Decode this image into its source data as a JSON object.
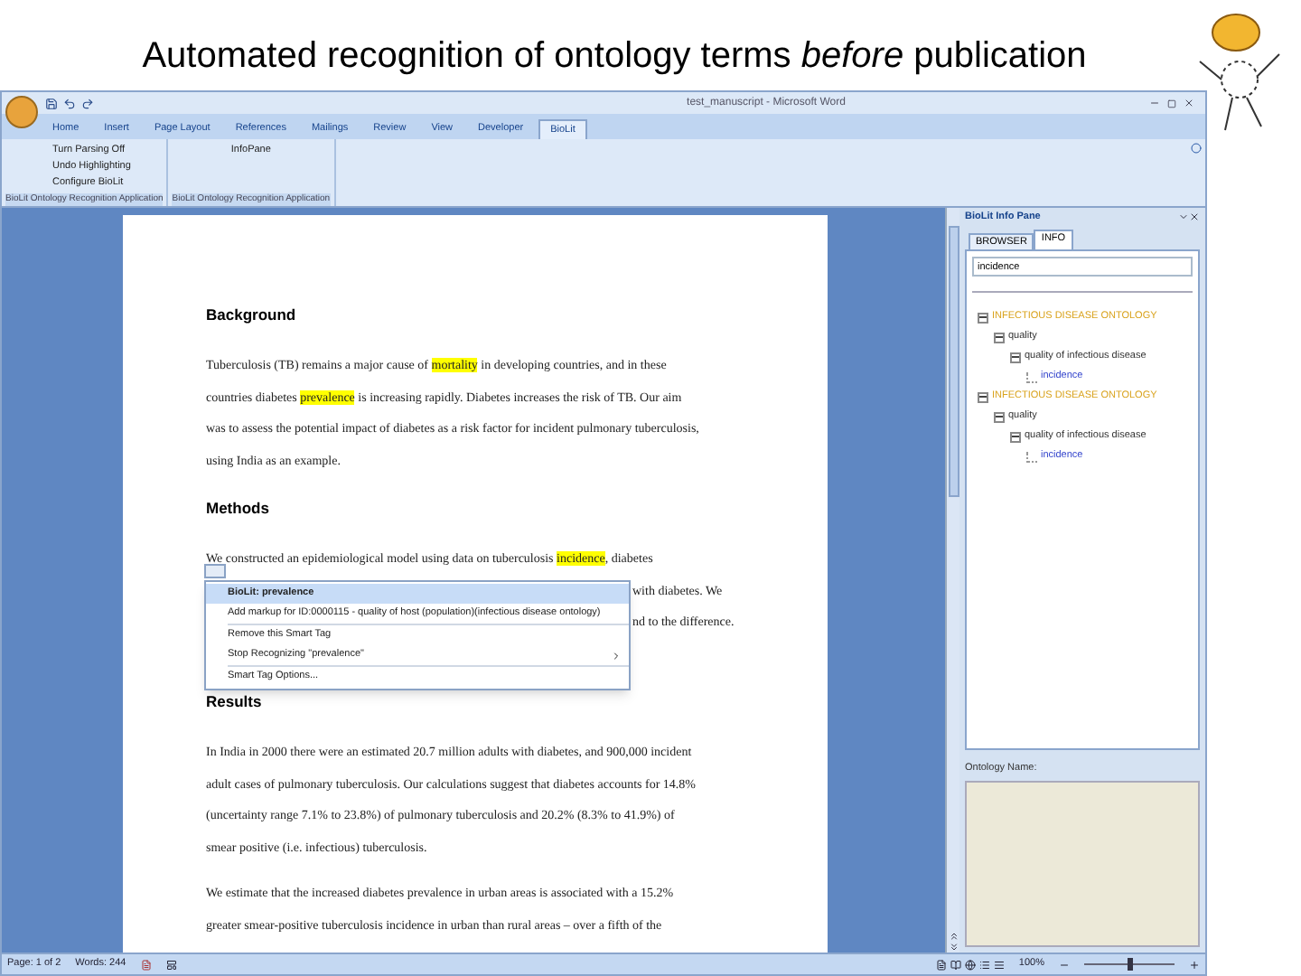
{
  "slide_title": "Automated recognition of ontology terms *before* publication",
  "window": {
    "title": "test_manuscript - Microsoft Word"
  },
  "ribbon_tabs": [
    {
      "label": "Home",
      "selected": false
    },
    {
      "label": "Insert",
      "selected": false
    },
    {
      "label": "Page Layout",
      "selected": false
    },
    {
      "label": "References",
      "selected": false
    },
    {
      "label": "Mailings",
      "selected": false
    },
    {
      "label": "Review",
      "selected": false
    },
    {
      "label": "View",
      "selected": false
    },
    {
      "label": "Developer",
      "selected": false
    },
    {
      "label": "BioLit",
      "selected": true
    }
  ],
  "ribbon_groups": [
    {
      "label": "BioLit Ontology Recognition Application",
      "buttons": [
        "Turn Parsing Off",
        "Undo Highlighting",
        "Configure BioLit"
      ]
    },
    {
      "label": "BioLit Ontology Recognition Application",
      "buttons": [
        "InfoPane"
      ]
    }
  ],
  "document": [
    {
      "heading": "Background",
      "paragraphs": [
        {
          "lines": [
            [
              {
                "text": "Tuberculosis (TB) remains a major cause of ",
                "highlighted": false
              },
              {
                "text": "mortality",
                "highlighted": true
              },
              {
                "text": " in developing countries, and in these",
                "highlighted": false
              }
            ],
            [
              {
                "text": "countries diabetes ",
                "highlighted": false
              },
              {
                "text": "prevalence",
                "highlighted": true
              },
              {
                "text": " is increasing rapidly. Diabetes increases the risk of TB. Our aim",
                "highlighted": false
              }
            ],
            [
              {
                "text": "was to assess the potential impact of diabetes as a risk factor for incident pulmonary tuberculosis,",
                "highlighted": false
              }
            ],
            [
              {
                "text": "using India as an example.",
                "highlighted": false
              }
            ]
          ]
        }
      ]
    },
    {
      "heading": "Methods",
      "paragraphs": [
        {
          "lines": [
            [
              {
                "text": "We constructed an epidemiological model using data on tuberculosis ",
                "highlighted": false
              },
              {
                "text": "incidence",
                "highlighted": true
              },
              {
                "text": ", diabetes",
                "highlighted": false
              }
            ]
          ],
          "partly_covered_lines": [
            "with diabetes. We",
            "nd to the difference."
          ]
        }
      ]
    },
    {
      "heading": "Results",
      "paragraphs": [
        {
          "lines": [
            [
              {
                "text": "In India in 2000 there were an estimated 20.7 million adults with diabetes, and 900,000 incident",
                "highlighted": false
              }
            ],
            [
              {
                "text": "adult cases of pulmonary tuberculosis. Our calculations suggest that diabetes accounts for 14.8%",
                "highlighted": false
              }
            ],
            [
              {
                "text": "(uncertainty range 7.1% to 23.8%) of pulmonary tuberculosis and 20.2% (8.3% to 41.9%) of",
                "highlighted": false
              }
            ],
            [
              {
                "text": "smear positive (i.e. infectious) tuberculosis.",
                "highlighted": false
              }
            ]
          ]
        },
        {
          "lines": [
            [
              {
                "text": "We estimate that the increased diabetes prevalence in urban areas is associated with a 15.2%",
                "highlighted": false
              }
            ],
            [
              {
                "text": "greater smear-positive tuberculosis incidence in urban than rural areas – over a fifth of the",
                "highlighted": false
              }
            ]
          ]
        }
      ]
    }
  ],
  "smart_tag_menu": [
    {
      "label": "BioLit: prevalence",
      "kind": "title",
      "divider_above": false
    },
    {
      "label": "Add markup for ID:0000115 - quality of host (population)(infectious disease ontology)",
      "kind": "item",
      "divider_above": false
    },
    {
      "label": "Remove this Smart Tag",
      "kind": "item",
      "divider_above": true
    },
    {
      "label": "Stop Recognizing \"prevalence\"",
      "kind": "submenu",
      "divider_above": false
    },
    {
      "label": "Smart Tag Options...",
      "kind": "item",
      "divider_above": true
    }
  ],
  "info_pane": {
    "title": "BioLit Info Pane",
    "tabs": [
      {
        "label": "BROWSER",
        "selected": false
      },
      {
        "label": "INFO",
        "selected": true
      }
    ],
    "search": {
      "value": "incidence"
    },
    "tree": [
      {
        "label": "INFECTIOUS DISEASE ONTOLOGY",
        "kind": "ontology",
        "expanded": true,
        "children": [
          {
            "label": "quality",
            "kind": "term",
            "expanded": true,
            "children": [
              {
                "label": "quality of infectious disease",
                "kind": "term",
                "expanded": true,
                "children": [
                  {
                    "label": "incidence",
                    "kind": "match"
                  }
                ]
              }
            ]
          }
        ]
      },
      {
        "label": "INFECTIOUS DISEASE ONTOLOGY",
        "kind": "ontology",
        "expanded": true,
        "children": [
          {
            "label": "quality",
            "kind": "term",
            "expanded": true,
            "children": [
              {
                "label": "quality of infectious disease",
                "kind": "term",
                "expanded": true,
                "children": [
                  {
                    "label": "incidence",
                    "kind": "match"
                  }
                ]
              }
            ]
          }
        ]
      }
    ],
    "ontology_name_label": "Ontology Name:"
  },
  "status_bar": {
    "page": "Page: 1 of 2",
    "words": "Words: 244",
    "zoom": "100%",
    "zoom_slider": {
      "level": 0.5
    }
  }
}
